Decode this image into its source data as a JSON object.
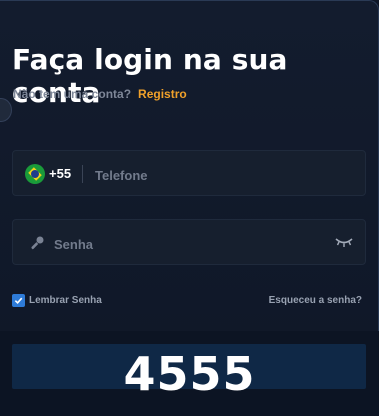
{
  "login": {
    "title": "Faça login na sua conta",
    "no_account_text": "Não tem uma conta?",
    "register_label": "Registro"
  },
  "phone": {
    "flag_icon": "brazil-flag-icon",
    "dial_code": "+55",
    "placeholder": "Telefone",
    "value": ""
  },
  "password": {
    "key_icon": "key-icon",
    "placeholder": "Senha",
    "value": "",
    "toggle_icon": "eye-closed-icon"
  },
  "remember": {
    "label": "Lembrar Senha",
    "checked": true
  },
  "forgot_label": "Esqueceu a senha?",
  "overlay_number": "4555",
  "colors": {
    "accent": "#f0a12a",
    "checkbox": "#2e7bd8",
    "background": "#0e1626",
    "field": "#161f2e"
  }
}
